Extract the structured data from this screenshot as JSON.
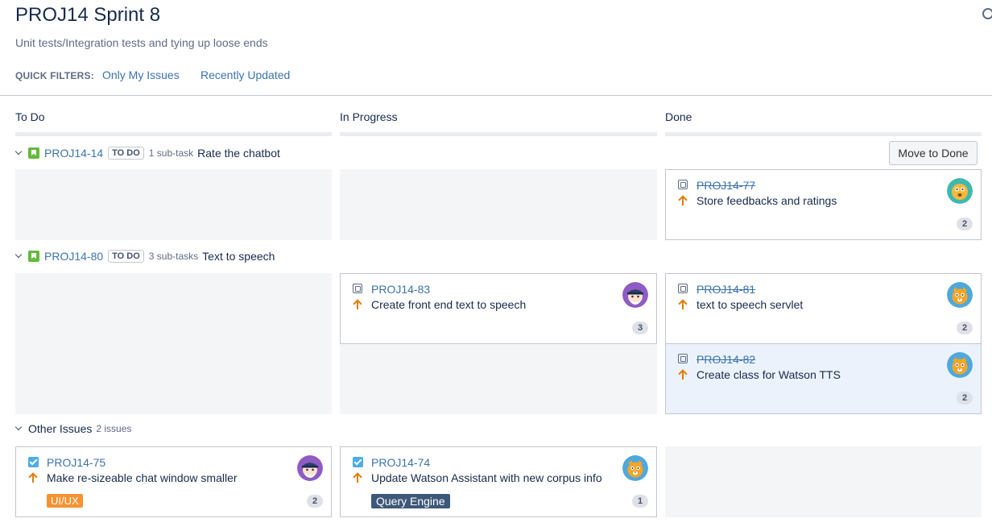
{
  "board": {
    "title": "PROJ14 Sprint 8",
    "subtitle": "Unit tests/Integration tests and tying up loose ends"
  },
  "quick_filters": {
    "label": "QUICK FILTERS:",
    "items": [
      "Only My Issues",
      "Recently Updated"
    ]
  },
  "columns": [
    "To Do",
    "In Progress",
    "Done"
  ],
  "swimlanes": [
    {
      "key": "PROJ14-14",
      "status": "TO DO",
      "subtasks": "1 sub-task",
      "summary": "Rate the chatbot",
      "action": "Move to Done",
      "cards": [
        {
          "key": "PROJ14-77",
          "summary": "Store feedbacks and ratings",
          "count": "2",
          "column": "Done",
          "avatar": "orange-monster-avatar"
        }
      ]
    },
    {
      "key": "PROJ14-80",
      "status": "TO DO",
      "subtasks": "3 sub-tasks",
      "summary": "Text to speech",
      "cards": [
        {
          "key": "PROJ14-83",
          "summary": "Create front end text to speech",
          "count": "3",
          "column": "In Progress",
          "avatar": "pirate-avatar"
        },
        {
          "key": "PROJ14-81",
          "summary": "text to speech servlet",
          "count": "2",
          "column": "Done",
          "avatar": "cat-avatar"
        },
        {
          "key": "PROJ14-82",
          "summary": "Create class for Watson TTS",
          "count": "2",
          "column": "Done",
          "avatar": "cat-avatar"
        }
      ]
    }
  ],
  "other_issues": {
    "label": "Other Issues",
    "count": "2 issues",
    "cards": [
      {
        "key": "PROJ14-75",
        "summary": "Make re-sizeable chat window smaller",
        "label": "UI/UX",
        "count": "2",
        "column": "To Do",
        "avatar": "pirate-avatar"
      },
      {
        "key": "PROJ14-74",
        "summary": "Update Watson Assistant with new corpus info",
        "label": "Query Engine",
        "count": "1",
        "column": "In Progress",
        "avatar": "cat-avatar"
      }
    ]
  },
  "colors": {
    "link": "#3b73af",
    "story": "#63ba3c",
    "priority_high": "#e37c00",
    "label_uiux": "#f79232",
    "label_query_engine": "#3d5879",
    "selected_card": "#ebf2fb"
  }
}
